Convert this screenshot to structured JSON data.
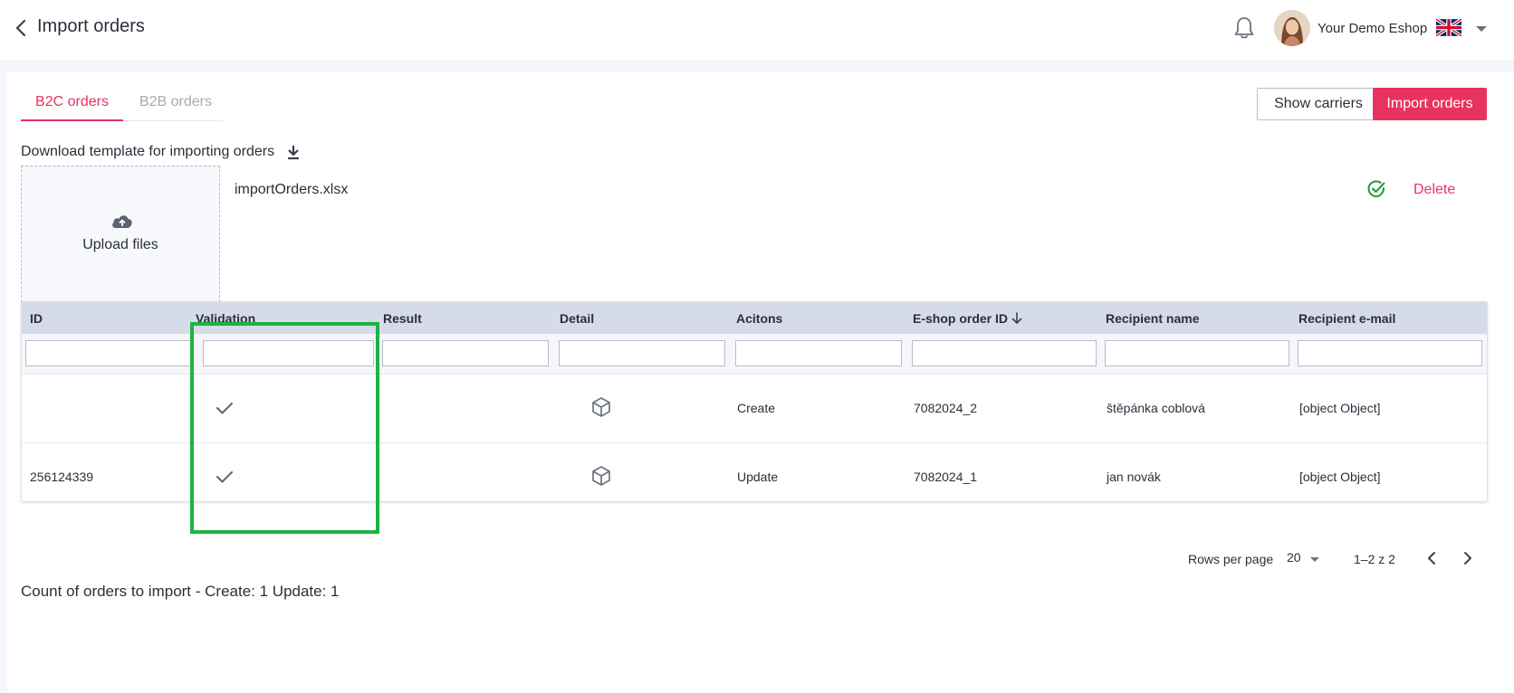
{
  "header": {
    "title": "Import orders",
    "shop_name": "Your Demo Eshop",
    "language_flag": "uk-flag-icon"
  },
  "tabs": [
    {
      "label": "B2C orders",
      "active": true
    },
    {
      "label": "B2B orders",
      "active": false
    }
  ],
  "actions": {
    "show_carriers": "Show carriers",
    "import_orders": "Import orders"
  },
  "template": {
    "download_label": "Download template for importing orders"
  },
  "upload": {
    "label": "Upload files",
    "file_name": "importOrders.xlsx",
    "status": "valid",
    "delete_label": "Delete"
  },
  "table": {
    "columns": [
      "ID",
      "Validation",
      "Result",
      "Detail",
      "Acitons",
      "E-shop order ID",
      "Recipient name",
      "Recipient e-mail"
    ],
    "sorted_column": "E-shop order ID",
    "sort_direction": "desc",
    "rows": [
      {
        "id": "",
        "validation": "check",
        "result": "",
        "detail": "box-icon",
        "action": "Create",
        "eshop_order_id": "7082024_2",
        "recipient_name": "štěpánka coblová",
        "recipient_email": "[object Object]"
      },
      {
        "id": "256124339",
        "validation": "check",
        "result": "",
        "detail": "box-icon",
        "action": "Update",
        "eshop_order_id": "7082024_1",
        "recipient_name": "jan novák",
        "recipient_email": "[object Object]"
      }
    ]
  },
  "pagination": {
    "rows_per_page_label": "Rows per page",
    "rows_per_page": "20",
    "range": "1–2 z 2"
  },
  "summary": {
    "count_text": "Count of orders to import - Create: 1 Update: 1"
  },
  "colors": {
    "accent": "#e8325f",
    "highlight": "#1db343",
    "success": "#1a9b3c",
    "table_header": "#d5dbe9"
  }
}
